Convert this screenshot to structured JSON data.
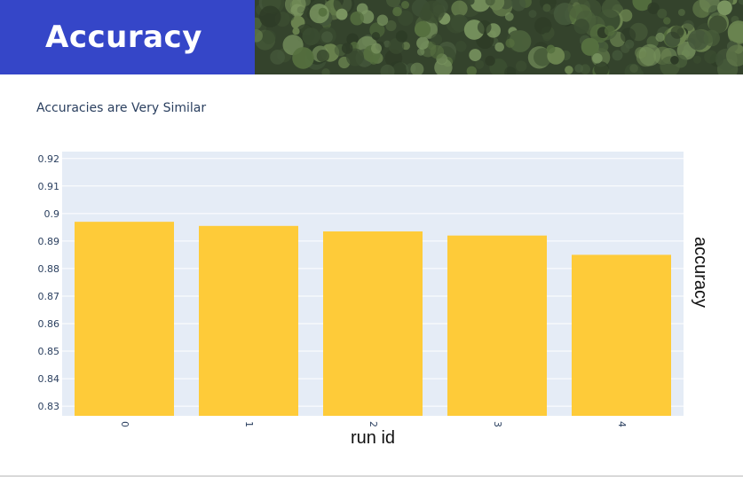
{
  "header": {
    "title": "Accuracy",
    "banner_image": "forest-canopy-aerial"
  },
  "chart_data": {
    "type": "bar",
    "title": "Accuracies are Very Similar",
    "xlabel": "run id",
    "ylabel": "accuracy",
    "categories": [
      "0",
      "1",
      "2",
      "3",
      "4"
    ],
    "values": [
      0.897,
      0.8955,
      0.8935,
      0.892,
      0.885
    ],
    "ylim": [
      0.8265,
      0.9225
    ],
    "yticks": [
      0.83,
      0.84,
      0.85,
      0.86,
      0.87,
      0.88,
      0.89,
      0.9,
      0.91,
      0.92
    ],
    "ytick_labels": [
      "0.83",
      "0.84",
      "0.85",
      "0.86",
      "0.87",
      "0.88",
      "0.89",
      "0.9",
      "0.91",
      "0.92"
    ],
    "grid": true,
    "colors": {
      "bar": "#fecb39",
      "plot_bg": "#e5ecf6",
      "grid": "#ffffff",
      "tick_text": "#2a3f5f",
      "title_bar": "#3546c8"
    }
  }
}
